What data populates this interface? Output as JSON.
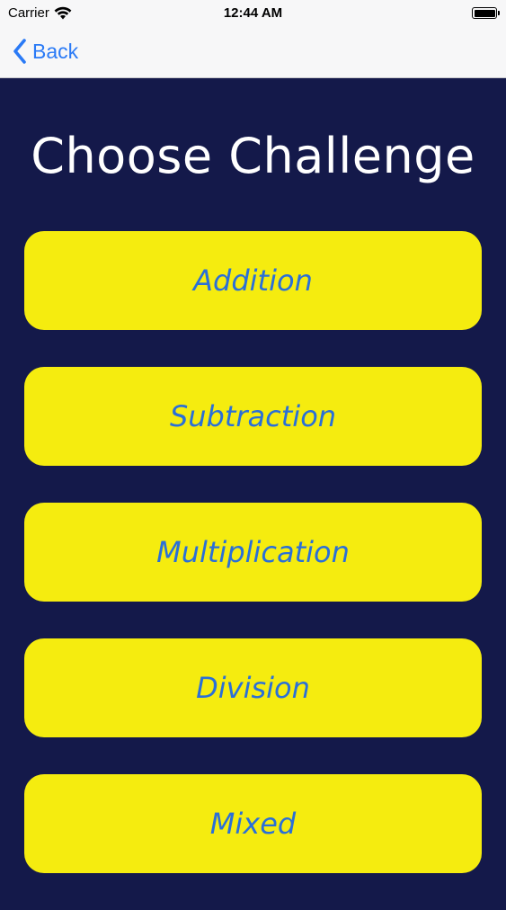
{
  "status_bar": {
    "carrier": "Carrier",
    "time": "12:44 AM"
  },
  "nav": {
    "back_label": "Back"
  },
  "screen": {
    "title": "Choose Challenge"
  },
  "challenges": [
    {
      "label": "Addition"
    },
    {
      "label": "Subtraction"
    },
    {
      "label": "Multiplication"
    },
    {
      "label": "Division"
    },
    {
      "label": "Mixed"
    }
  ],
  "colors": {
    "background": "#14194a",
    "button_fill": "#f5ec0f",
    "button_text": "#2a6fd8",
    "nav_tint": "#2a7af6"
  },
  "icons": {
    "back": "chevron-left-icon",
    "wifi": "wifi-icon",
    "battery": "battery-icon"
  }
}
